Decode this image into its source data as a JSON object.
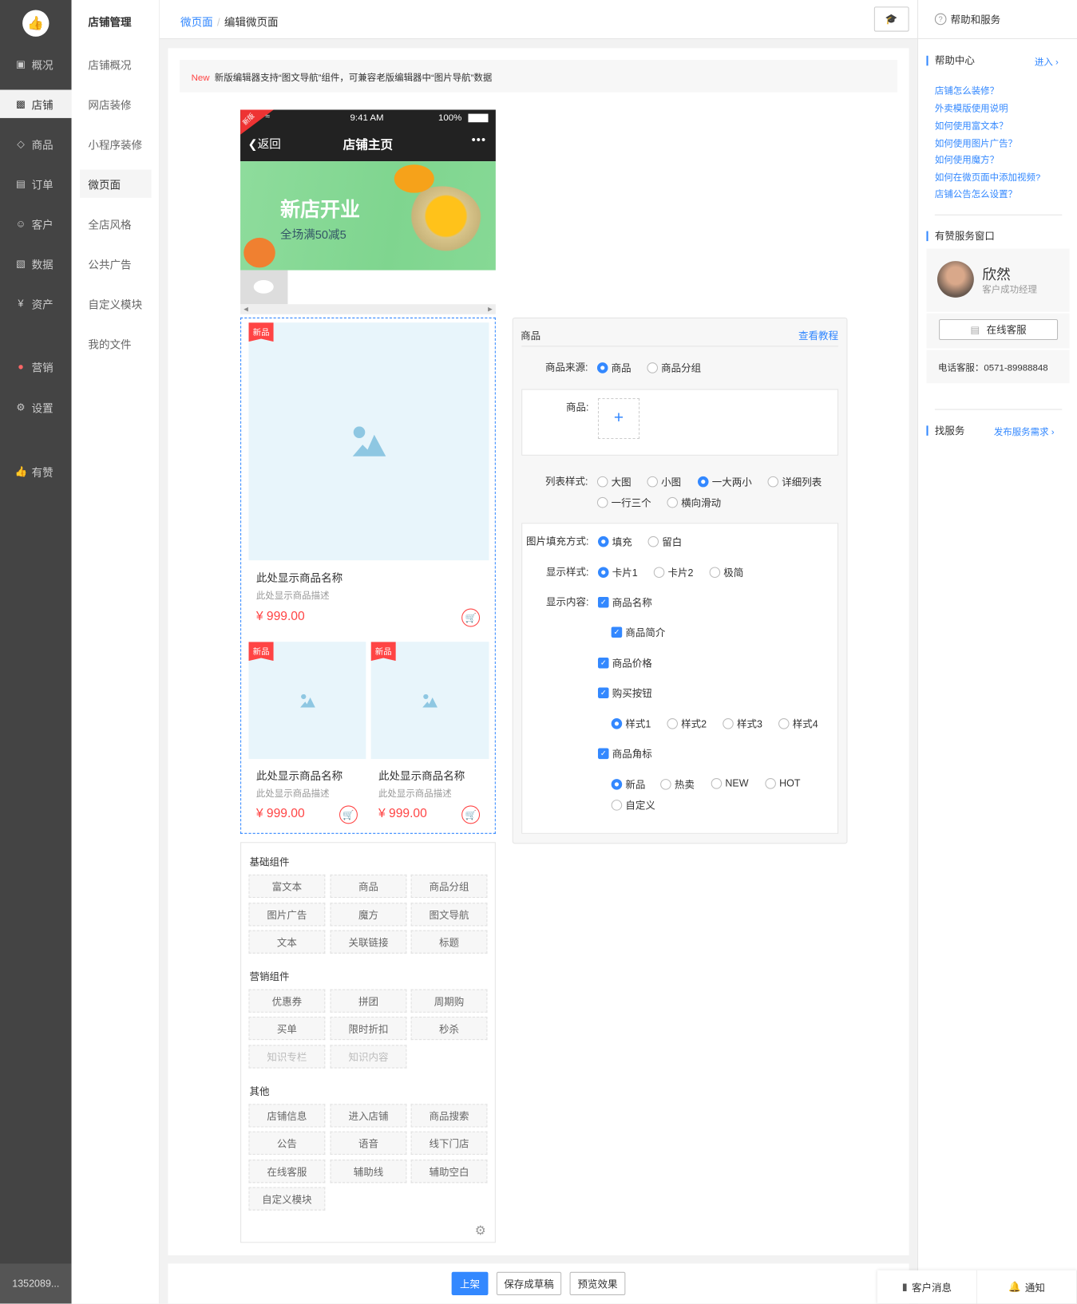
{
  "nav_primary": {
    "items": [
      {
        "label": "概况",
        "icon": "dashboard-icon"
      },
      {
        "label": "店铺",
        "icon": "store-icon",
        "active": true
      },
      {
        "label": "商品",
        "icon": "tag-icon"
      },
      {
        "label": "订单",
        "icon": "order-icon"
      },
      {
        "label": "客户",
        "icon": "user-icon"
      },
      {
        "label": "数据",
        "icon": "chart-icon"
      },
      {
        "label": "资产",
        "icon": "yen-icon"
      },
      {
        "label": "营销",
        "icon": "apps-icon"
      },
      {
        "label": "设置",
        "icon": "gear-icon"
      },
      {
        "label": "有赞",
        "icon": "thumb-icon"
      }
    ],
    "account": "1352089..."
  },
  "nav_secondary": {
    "title": "店铺管理",
    "items": [
      "店铺概况",
      "网店装修",
      "小程序装修",
      "微页面",
      "全店风格",
      "公共广告",
      "自定义模块",
      "我的文件"
    ],
    "active": "微页面"
  },
  "breadcrumb": {
    "parent": "微页面",
    "current": "编辑微页面"
  },
  "notice": {
    "badge": "New",
    "text": "新版编辑器支持“图文导航”组件，可兼容老版编辑器中“图片导航”数据"
  },
  "phone": {
    "corner": "新版",
    "time": "9:41 AM",
    "battery": "100%",
    "back": "返回",
    "title": "店铺主页",
    "banner_title": "新店开业",
    "banner_sub": "全场满50减5",
    "goods": [
      {
        "tag": "新品",
        "name": "此处显示商品名称",
        "desc": "此处显示商品描述",
        "price": "¥ 999.00"
      },
      {
        "tag": "新品",
        "name": "此处显示商品名称",
        "desc": "此处显示商品描述",
        "price": "¥ 999.00"
      },
      {
        "tag": "新品",
        "name": "此处显示商品名称",
        "desc": "此处显示商品描述",
        "price": "¥ 999.00"
      }
    ]
  },
  "components": {
    "groups": [
      {
        "title": "基础组件",
        "items": [
          "富文本",
          "商品",
          "商品分组",
          "图片广告",
          "魔方",
          "图文导航",
          "文本",
          "关联链接",
          "标题"
        ]
      },
      {
        "title": "营销组件",
        "items": [
          "优惠券",
          "拼团",
          "周期购",
          "买单",
          "限时折扣",
          "秒杀",
          "知识专栏",
          "知识内容"
        ],
        "disabled": [
          "知识专栏",
          "知识内容"
        ]
      },
      {
        "title": "其他",
        "items": [
          "店铺信息",
          "进入店铺",
          "商品搜索",
          "公告",
          "语音",
          "线下门店",
          "在线客服",
          "辅助线",
          "辅助空白",
          "自定义模块"
        ]
      }
    ]
  },
  "editor": {
    "title": "商品",
    "tutorial": "查看教程",
    "source": {
      "label": "商品来源:",
      "options": [
        "商品",
        "商品分组"
      ],
      "selected": "商品"
    },
    "goods_label": "商品:",
    "list_style": {
      "label": "列表样式:",
      "options": [
        "大图",
        "小图",
        "一大两小",
        "详细列表",
        "一行三个",
        "横向滑动"
      ],
      "selected": "一大两小"
    },
    "fill": {
      "label": "图片填充方式:",
      "options": [
        "填充",
        "留白"
      ],
      "selected": "填充"
    },
    "display_style": {
      "label": "显示样式:",
      "options": [
        "卡片1",
        "卡片2",
        "极简"
      ],
      "selected": "卡片1"
    },
    "content": {
      "label": "显示内容:",
      "checks": [
        "商品名称",
        "商品简介",
        "商品价格",
        "购买按钮",
        "商品角标"
      ]
    },
    "buy_style": {
      "options": [
        "样式1",
        "样式2",
        "样式3",
        "样式4"
      ],
      "selected": "样式1"
    },
    "corner": {
      "options": [
        "新品",
        "热卖",
        "NEW",
        "HOT",
        "自定义"
      ],
      "selected": "新品"
    }
  },
  "help": {
    "header": "帮助和服务",
    "center": "帮助中心",
    "enter": "进入",
    "links": [
      "店铺怎么装修？",
      "外卖模版使用说明",
      "如何使用富文本？",
      "如何使用图片广告？",
      "如何使用魔方？",
      "如何在微页面中添加视频?",
      "店铺公告怎么设置？"
    ],
    "service": "有赞服务窗口",
    "agent_name": "欣然",
    "agent_role": "客户成功经理",
    "online": "在线客服",
    "phone": "电话客服：0571-89988848",
    "find": "找服务",
    "publish": "发布服务需求"
  },
  "actions": {
    "publish": "上架",
    "draft": "保存成草稿",
    "preview": "预览效果"
  },
  "float": {
    "messages": "客户消息",
    "notify": "通知"
  }
}
